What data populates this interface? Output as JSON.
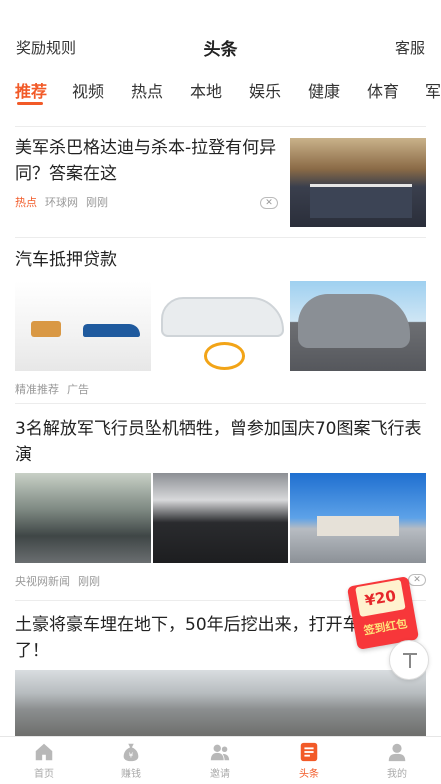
{
  "header": {
    "left_label": "奖励规则",
    "title": "头条",
    "right_label": "客服"
  },
  "tabs": [
    {
      "label": "推荐"
    },
    {
      "label": "视频"
    },
    {
      "label": "热点"
    },
    {
      "label": "本地"
    },
    {
      "label": "娱乐"
    },
    {
      "label": "健康"
    },
    {
      "label": "体育"
    },
    {
      "label": "军"
    }
  ],
  "articles": [
    {
      "title": "美军杀巴格达迪与杀本-拉登有何异同？答案在这",
      "tag": "热点",
      "source": "环球网",
      "time": "刚刚"
    },
    {
      "title": "汽车抵押贷款",
      "source": "精准推荐",
      "tag": "广告"
    },
    {
      "title": "3名解放军飞行员坠机牺牲，曾参加国庆70图案飞行表演",
      "source": "央视网新闻",
      "time": "刚刚"
    },
    {
      "title": "土豪将豪车埋在地下，50年后挖出来，打开车人傻眼了！"
    }
  ],
  "redpacket": {
    "amount": "¥20",
    "label": "签到红包"
  },
  "tabbar": [
    {
      "label": "首页",
      "icon": "home-icon"
    },
    {
      "label": "赚钱",
      "icon": "money-bag-icon"
    },
    {
      "label": "邀请",
      "icon": "invite-icon"
    },
    {
      "label": "头条",
      "icon": "headlines-icon"
    },
    {
      "label": "我的",
      "icon": "profile-icon"
    }
  ],
  "colors": {
    "accent": "#f25a28",
    "redpacket": "#f7373a"
  }
}
